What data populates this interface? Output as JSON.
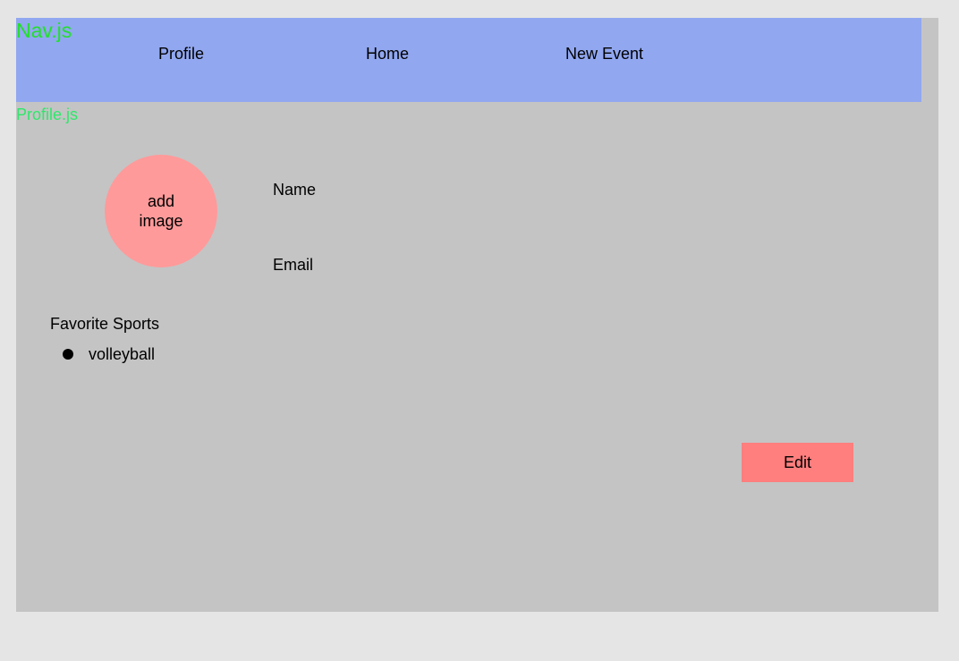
{
  "nav": {
    "component_label": "Nav.js",
    "links": [
      {
        "label": "Profile"
      },
      {
        "label": "Home"
      },
      {
        "label": "New Event"
      }
    ]
  },
  "profile": {
    "component_label": "Profile.js",
    "avatar_text": "add image",
    "name_label": "Name",
    "email_label": "Email",
    "sports_title": "Favorite Sports",
    "sports": [
      "volleyball"
    ],
    "edit_label": "Edit"
  },
  "colors": {
    "background": "#e5e5e5",
    "frame": "#c4c4c4",
    "nav": "#91a7f0",
    "component_label": "#22e02a",
    "avatar": "#ff9a9a",
    "edit_button": "#ff7e7e"
  }
}
